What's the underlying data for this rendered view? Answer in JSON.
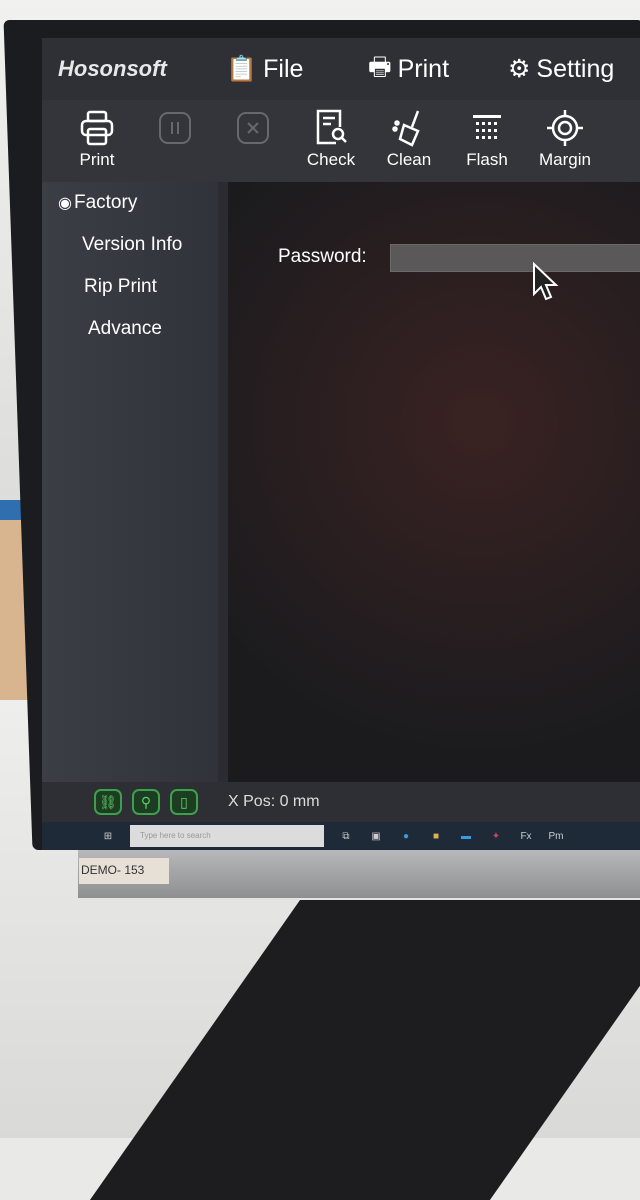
{
  "app": {
    "logo": "Hosonsoft"
  },
  "menu": [
    {
      "label": "File",
      "icon": "clipboard-check-icon"
    },
    {
      "label": "Print",
      "icon": "printer-icon"
    },
    {
      "label": "Setting",
      "icon": "gear-icon"
    }
  ],
  "toolbar": [
    {
      "label": "Print",
      "icon": "printer-icon",
      "enabled": true
    },
    {
      "label": "",
      "icon": "pause-icon",
      "enabled": false
    },
    {
      "label": "",
      "icon": "cancel-icon",
      "enabled": false
    },
    {
      "label": "Check",
      "icon": "document-search-icon",
      "enabled": true
    },
    {
      "label": "Clean",
      "icon": "broom-icon",
      "enabled": true
    },
    {
      "label": "Flash",
      "icon": "nozzle-grid-icon",
      "enabled": true
    },
    {
      "label": "Margin",
      "icon": "target-icon",
      "enabled": true
    }
  ],
  "sidebar": {
    "items": [
      {
        "label": "Factory",
        "selected": true
      },
      {
        "label": "Version Info"
      },
      {
        "label": "Rip Print"
      },
      {
        "label": "Advance"
      }
    ]
  },
  "main": {
    "password_label": "Password:",
    "password_value": ""
  },
  "status": {
    "xpos": "X Pos: 0 mm"
  },
  "taskbar": {
    "search_placeholder": "Type here to search",
    "apps": [
      "Fx",
      "Pm"
    ]
  },
  "monitor": {
    "label": "DEMO- 153"
  },
  "colors": {
    "status_button": "#3da04a"
  }
}
